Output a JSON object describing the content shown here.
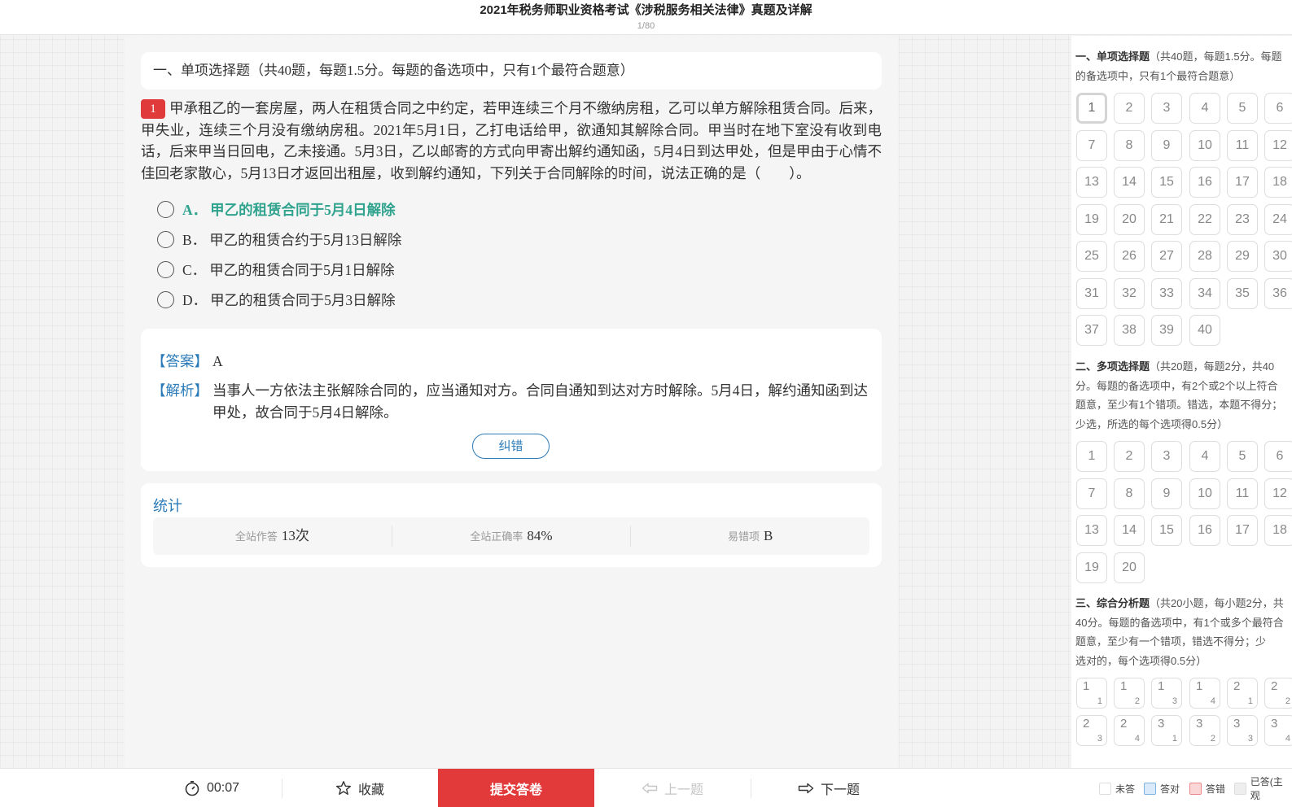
{
  "header": {
    "title": "2021年税务师职业资格考试《涉税服务相关法律》真题及详解",
    "progress": "1/80"
  },
  "question": {
    "section_heading": "一、单项选择题（共40题，每题1.5分。每题的备选项中，只有1个最符合题意）",
    "number": "1",
    "text": "甲承租乙的一套房屋，两人在租赁合同之中约定，若甲连续三个月不缴纳房租，乙可以单方解除租赁合同。后来，甲失业，连续三个月没有缴纳房租。2021年5月1日，乙打电话给甲，欲通知其解除合同。甲当时在地下室没有收到电话，后来甲当日回电，乙未接通。5月3日，乙以邮寄的方式向甲寄出解约通知函，5月4日到达甲处，但是甲由于心情不佳回老家散心，5月13日才返回出租屋，收到解约通知，下列关于合同解除的时间，说法正确的是（　　）。",
    "options": [
      {
        "letter": "A．",
        "text": "甲乙的租赁合同于5月4日解除",
        "correct": true
      },
      {
        "letter": "B．",
        "text": "甲乙的租赁合约于5月13日解除",
        "correct": false
      },
      {
        "letter": "C．",
        "text": "甲乙的租赁合同于5月1日解除",
        "correct": false
      },
      {
        "letter": "D．",
        "text": "甲乙的租赁合同于5月3日解除",
        "correct": false
      }
    ]
  },
  "answer": {
    "answer_label": "【答案】",
    "answer_value": "A",
    "analysis_label": "【解析】",
    "analysis_text": "当事人一方依法主张解除合同的，应当通知对方。合同自通知到达对方时解除。5月4日，解约通知函到达甲处，故合同于5月4日解除。",
    "report_button": "纠错"
  },
  "stats": {
    "title": "统计",
    "items": [
      {
        "label": "全站作答",
        "value": "13次"
      },
      {
        "label": "全站正确率",
        "value": "84%"
      },
      {
        "label": "易错项",
        "value": "B"
      }
    ]
  },
  "sidebar": {
    "sections": [
      {
        "name": "一、单项选择题",
        "desc_lines": [
          "（共40题，每题1.5分。每题",
          "的备选项中，只有1个最符合题意）"
        ],
        "count": 40
      },
      {
        "name": "二、多项选择题",
        "desc_lines": [
          "（共20题，每题2分，共40",
          "分。每题的备选项中，有2个或2个以上符合",
          "题意，至少有1个错项。错选，本题不得分；",
          "少选，所选的每个选项得0.5分）"
        ],
        "count": 20
      },
      {
        "name": "三、综合分析题",
        "desc_lines": [
          "（共20小题，每小题2分，共",
          "40分。每题的备选项中，有1个或多个最符合",
          "题意，至少有一个错项，错选不得分；少",
          "选对的，每个选项得0.5分）"
        ],
        "pairs": [
          [
            "1",
            "1"
          ],
          [
            "1",
            "2"
          ],
          [
            "1",
            "3"
          ],
          [
            "1",
            "4"
          ],
          [
            "2",
            "1"
          ],
          [
            "2",
            "2"
          ],
          [
            "2",
            "3"
          ],
          [
            "2",
            "4"
          ],
          [
            "3",
            "1"
          ],
          [
            "3",
            "2"
          ],
          [
            "3",
            "3"
          ],
          [
            "3",
            "4"
          ]
        ]
      }
    ],
    "current_question": 1
  },
  "bottom": {
    "timer": "00:07",
    "favorite": "收藏",
    "submit": "提交答卷",
    "prev": "上一题",
    "next": "下一题",
    "legend": [
      {
        "label": "未答",
        "color": "#ffffff"
      },
      {
        "label": "答对",
        "color": "#d9ebfb"
      },
      {
        "label": "答错",
        "color": "#fbd6d6"
      },
      {
        "label": "已答(主观",
        "color": "#eeeeee"
      }
    ]
  }
}
